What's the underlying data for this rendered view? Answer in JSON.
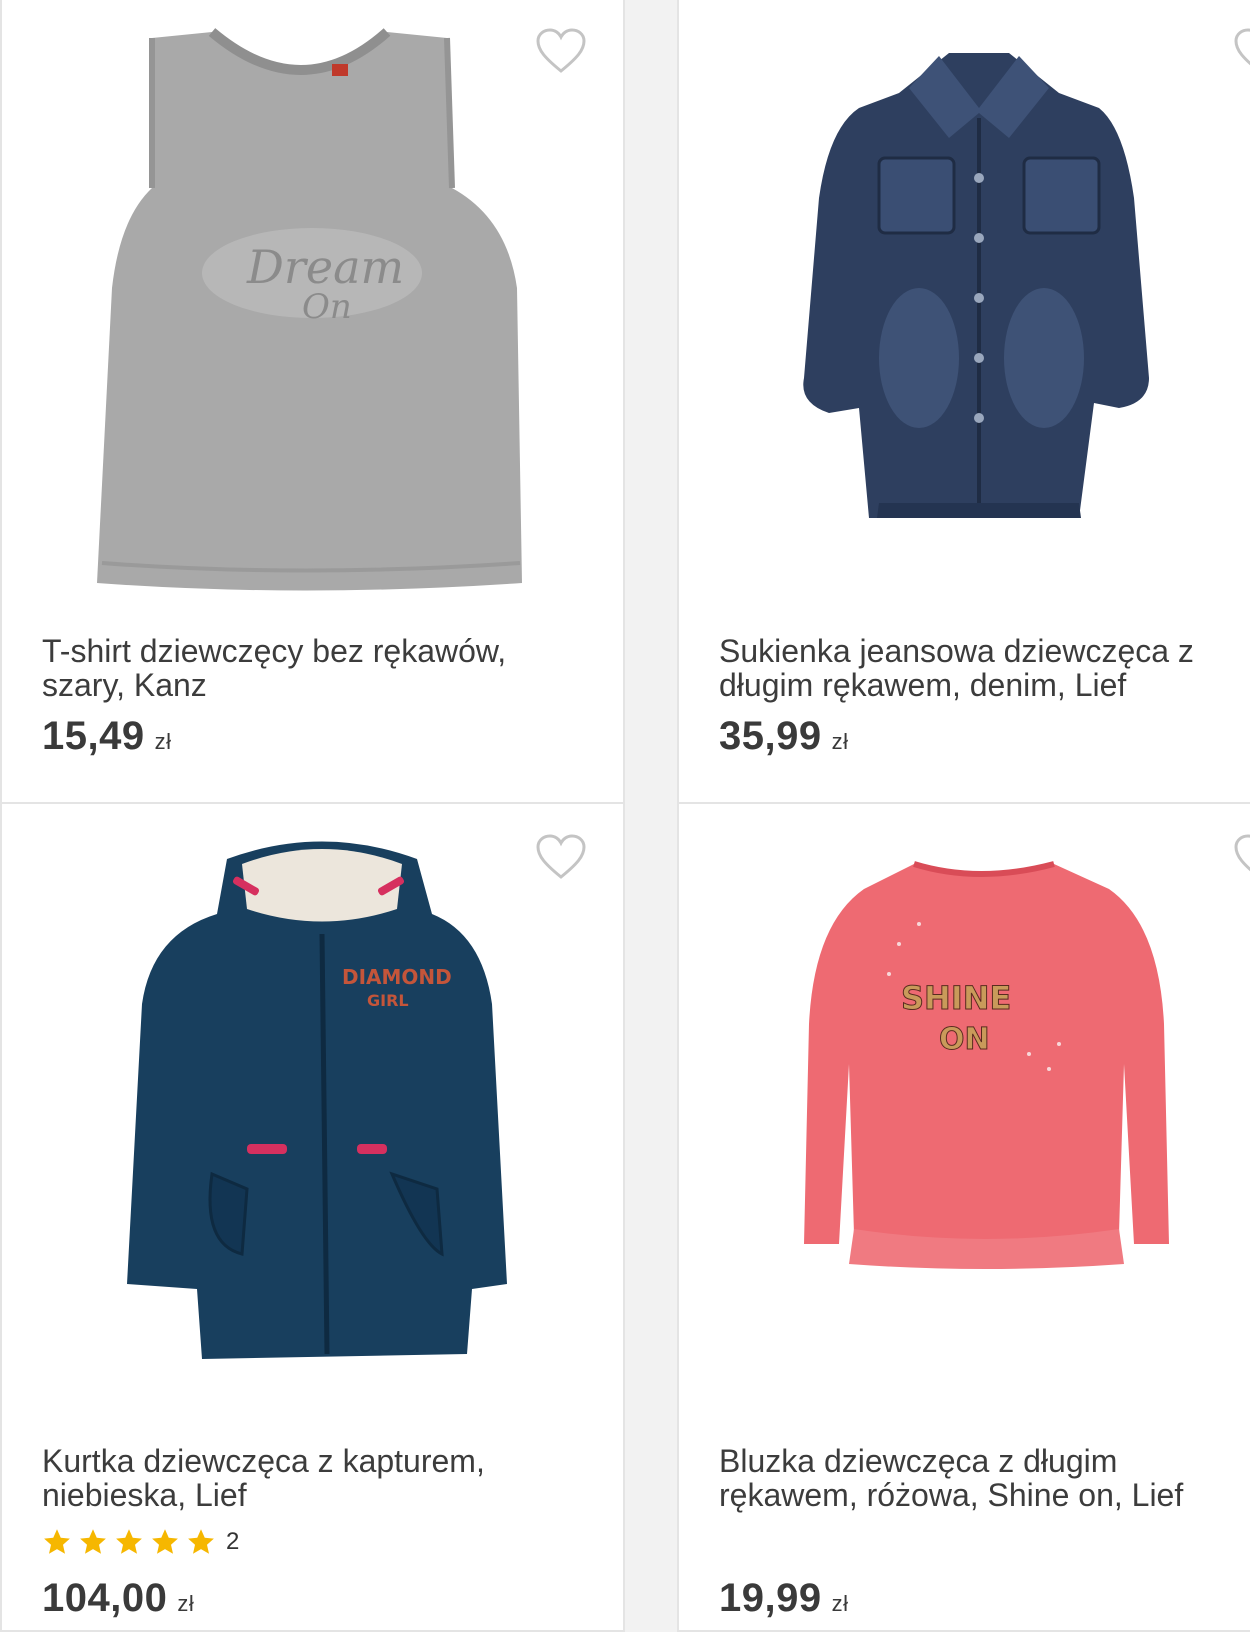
{
  "products": [
    {
      "title": "T-shirt dziewczęcy bez rękawów, szary, Kanz",
      "price": "15,49",
      "currency": "zł",
      "color": "#a9a9a9",
      "print_text": [
        "Dream",
        "On"
      ]
    },
    {
      "title": "Sukienka jeansowa dziewczęca z długim rękawem, denim, Lief",
      "price": "35,99",
      "currency": "zł",
      "color": "#2e3f5f"
    },
    {
      "title": "Kurtka dziewczęca z kapturem, niebieska, Lief",
      "price": "104,00",
      "currency": "zł",
      "rating": {
        "stars": 5,
        "count": "2"
      },
      "color": "#183f5e",
      "print_text": [
        "DIAMOND",
        "GIRL"
      ]
    },
    {
      "title": "Bluzka dziewczęca z długim rękawem, różowa, Shine on, Lief",
      "price": "19,99",
      "currency": "zł",
      "color": "#ee6a72",
      "print_text": [
        "SHINE",
        "ON"
      ]
    }
  ],
  "ui": {
    "favorite_icon": "heart-outline-icon",
    "star_icon": "star-icon",
    "star_color": "#f6b700",
    "heart_color": "#c4c4c4"
  }
}
